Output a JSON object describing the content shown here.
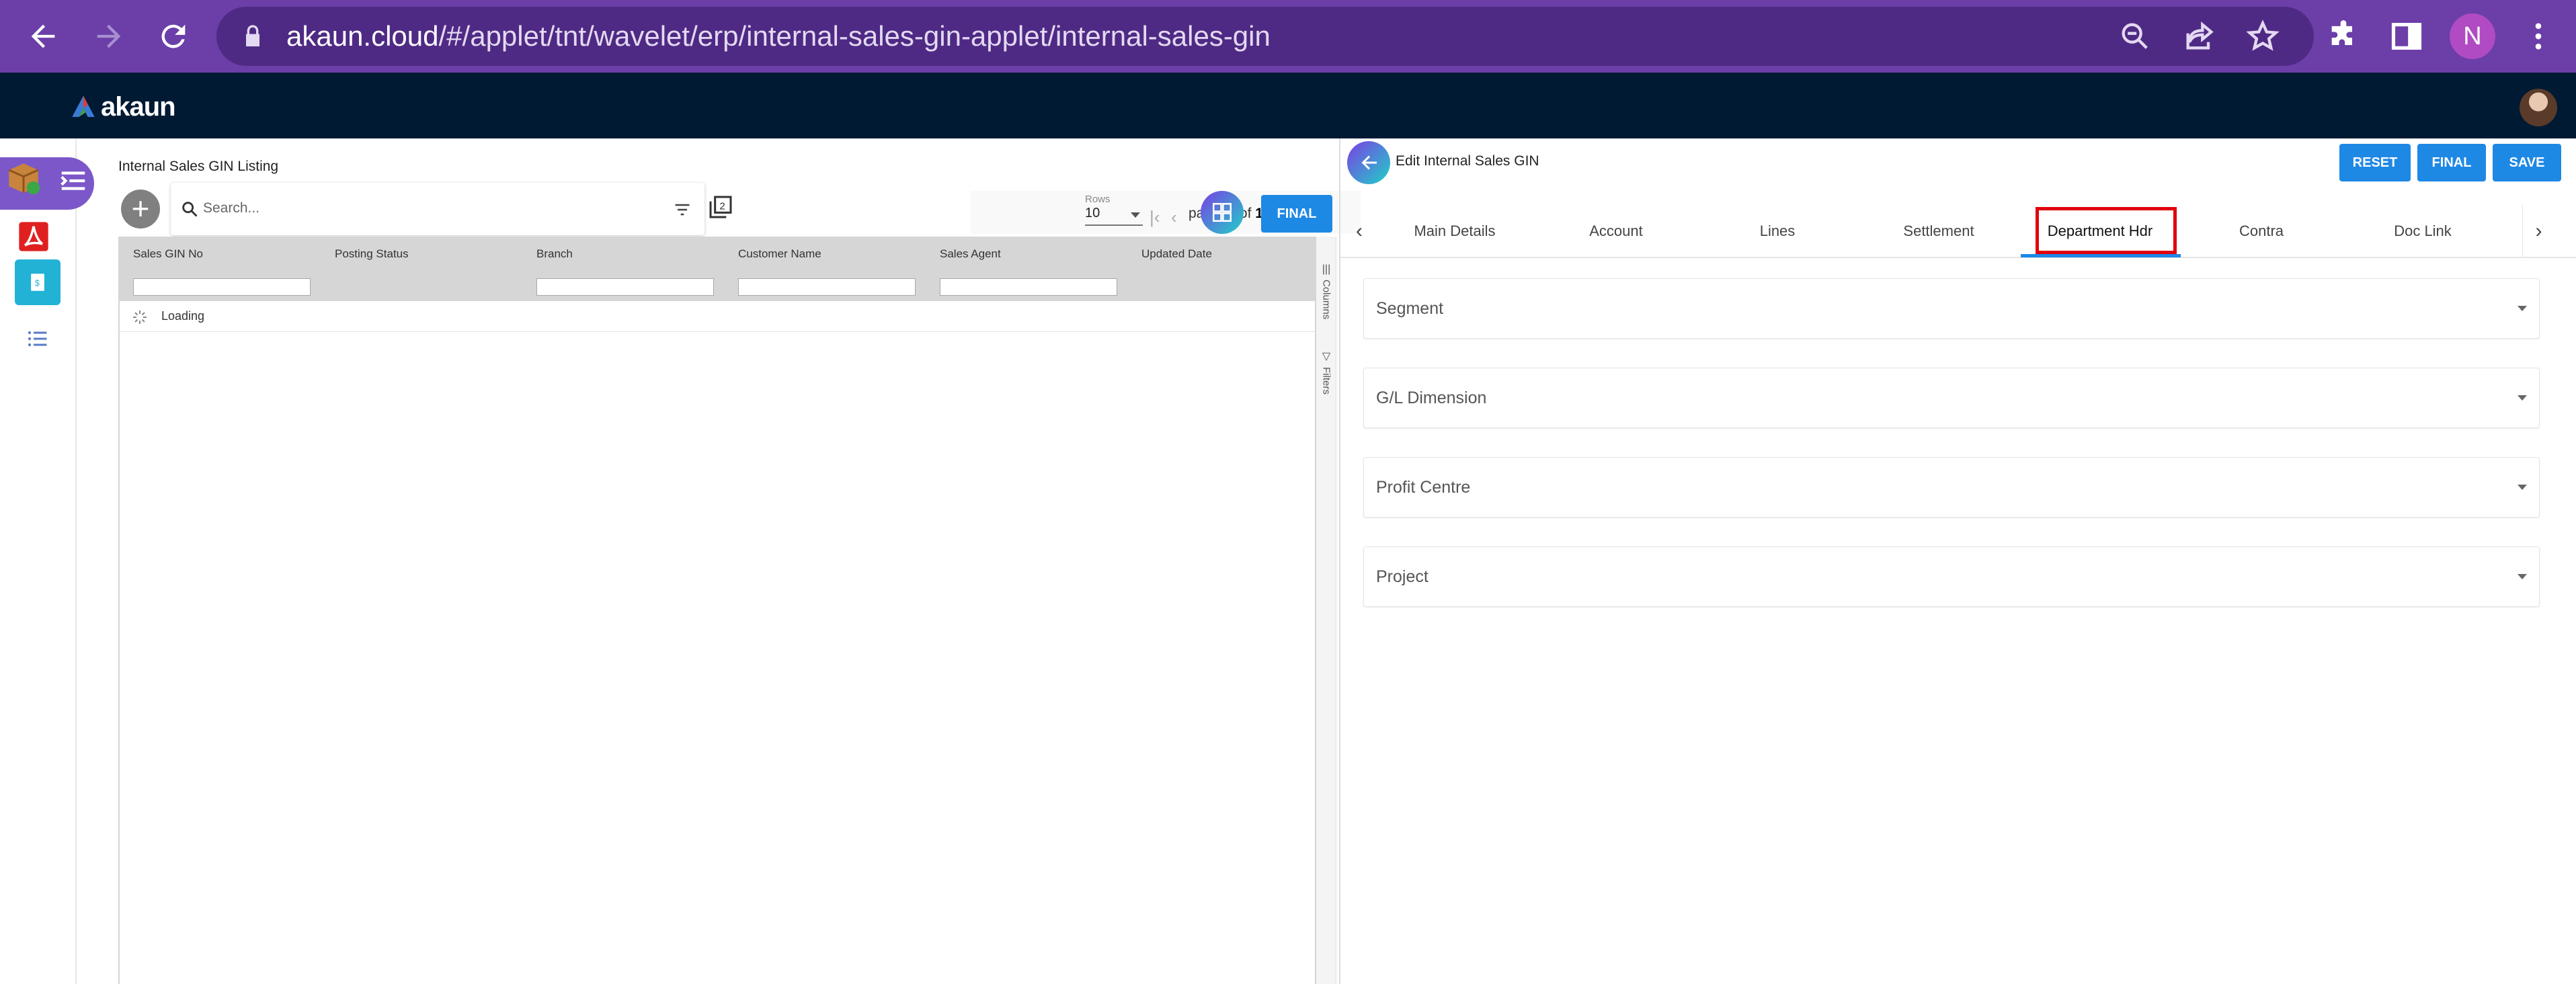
{
  "browser": {
    "url_host": "akaun.cloud",
    "url_path": "/#/applet/tnt/wavelet/erp/internal-sales-gin-applet/internal-sales-gin",
    "profile_initial": "N"
  },
  "app": {
    "brand": "akaun"
  },
  "listing": {
    "title": "Internal Sales GIN Listing",
    "search_placeholder": "Search...",
    "rows_label": "Rows",
    "rows_value": "10",
    "page_word": "page",
    "page_current": "1",
    "of_word": "of",
    "page_total": "1",
    "final_label": "FINAL",
    "columns": [
      "Sales GIN No",
      "Posting Status",
      "Branch",
      "Customer Name",
      "Sales Agent",
      "Updated Date"
    ],
    "loading_text": "Loading",
    "side_tabs": [
      "Columns",
      "Filters"
    ]
  },
  "edit": {
    "title": "Edit Internal Sales GIN",
    "buttons": {
      "reset": "RESET",
      "final": "FINAL",
      "save": "SAVE"
    },
    "tabs": [
      "Main Details",
      "Account",
      "Lines",
      "Settlement",
      "Department Hdr",
      "Contra",
      "Doc Link"
    ],
    "active_tab": "Department Hdr",
    "fields": [
      "Segment",
      "G/L Dimension",
      "Profit Centre",
      "Project"
    ]
  },
  "colors": {
    "chrome": "#6b3ea8",
    "app_header": "#001a33",
    "accent": "#1e88e5",
    "highlight": "#e0000e"
  },
  "icons": [
    "back-arrow-icon",
    "forward-arrow-icon",
    "reload-icon",
    "lock-icon",
    "zoom-icon",
    "share-icon",
    "star-icon",
    "extensions-icon",
    "side-panel-icon",
    "kebab-menu-icon",
    "plus-icon",
    "search-icon",
    "filter-icon",
    "count-badge-icon",
    "grid-view-icon",
    "loading-spinner-icon",
    "columns-icon",
    "filters-icon",
    "chevron-left-icon",
    "chevron-right-icon",
    "dropdown-caret-icon"
  ]
}
